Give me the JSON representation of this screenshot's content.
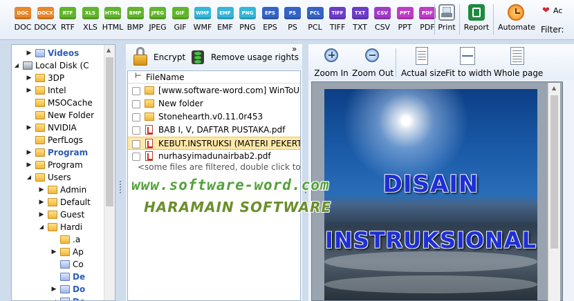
{
  "formats": [
    {
      "label": "DOC",
      "color": "#e8862a"
    },
    {
      "label": "DOCX",
      "color": "#e8862a"
    },
    {
      "label": "RTF",
      "color": "#61b52b"
    },
    {
      "label": "XLS",
      "color": "#61b52b"
    },
    {
      "label": "HTML",
      "color": "#61b52b"
    },
    {
      "label": "BMP",
      "color": "#61b52b"
    },
    {
      "label": "JPEG",
      "color": "#61b52b"
    },
    {
      "label": "GIF",
      "color": "#61b52b"
    },
    {
      "label": "WMF",
      "color": "#34b6d9"
    },
    {
      "label": "EMF",
      "color": "#34b6d9"
    },
    {
      "label": "PNG",
      "color": "#34b6d9"
    },
    {
      "label": "EPS",
      "color": "#3563c6"
    },
    {
      "label": "PS",
      "color": "#3563c6"
    },
    {
      "label": "PCL",
      "color": "#3563c6"
    },
    {
      "label": "TIFF",
      "color": "#6c3cc7"
    },
    {
      "label": "TXT",
      "color": "#6c3cc7"
    },
    {
      "label": "CSV",
      "color": "#9f3cc7"
    },
    {
      "label": "PPT",
      "color": "#c03cc7"
    },
    {
      "label": "PDF",
      "color": "#c03cc7"
    }
  ],
  "toolbar": {
    "print": "Print",
    "report": "Report",
    "automate": "Automate",
    "filter": "Filter:",
    "ac": "Ac"
  },
  "tree": [
    {
      "label": "Videos",
      "depth": 1,
      "arrow": "right",
      "bold": true,
      "color": "#2b5cb3",
      "special": true
    },
    {
      "label": "Local Disk (C",
      "depth": 0,
      "arrow": "down",
      "drive": true
    },
    {
      "label": "3DP",
      "depth": 1,
      "arrow": "right"
    },
    {
      "label": "Intel",
      "depth": 1,
      "arrow": "right"
    },
    {
      "label": "MSOCache",
      "depth": 1,
      "arrow": ""
    },
    {
      "label": "New Folder",
      "depth": 1,
      "arrow": ""
    },
    {
      "label": "NVIDIA",
      "depth": 1,
      "arrow": "right"
    },
    {
      "label": "PerfLogs",
      "depth": 1,
      "arrow": ""
    },
    {
      "label": "Program",
      "depth": 1,
      "arrow": "right",
      "bold": true,
      "color": "#2b5cb3"
    },
    {
      "label": "Program",
      "depth": 1,
      "arrow": "right"
    },
    {
      "label": "Users",
      "depth": 1,
      "arrow": "down"
    },
    {
      "label": "Admin",
      "depth": 2,
      "arrow": "right"
    },
    {
      "label": "Default",
      "depth": 2,
      "arrow": "right"
    },
    {
      "label": "Guest",
      "depth": 2,
      "arrow": "right"
    },
    {
      "label": "Hardi",
      "depth": 2,
      "arrow": "down"
    },
    {
      "label": ".a",
      "depth": 3,
      "arrow": ""
    },
    {
      "label": "Ap",
      "depth": 3,
      "arrow": "right"
    },
    {
      "label": "Co",
      "depth": 3,
      "arrow": "",
      "special": true
    },
    {
      "label": "De",
      "depth": 3,
      "arrow": "",
      "bold": true,
      "color": "#2b5cb3",
      "special": true
    },
    {
      "label": "Do",
      "depth": 3,
      "arrow": "right",
      "bold": true,
      "color": "#2b5cb3",
      "special": true
    },
    {
      "label": "Do",
      "depth": 3,
      "arrow": "down",
      "bold": true,
      "color": "#2b5cb3",
      "special": true
    }
  ],
  "filePanel": {
    "encrypt": "Encrypt",
    "removeUsage": "Remove usage rights",
    "more": "»",
    "columnHeader": "FileName",
    "files": [
      {
        "name": "[www.software-word.com] WinToUSB",
        "type": "folder"
      },
      {
        "name": "New folder",
        "type": "folder"
      },
      {
        "name": "Stonehearth.v0.11.0r453",
        "type": "folder"
      },
      {
        "name": "BAB I, V, DAFTAR PUSTAKA.pdf",
        "type": "pdf"
      },
      {
        "name": "KEBUT.INSTRUKSI (MATERI PEKERTI",
        "type": "pdf",
        "selected": true
      },
      {
        "name": "nurhasyimadunairbab2.pdf",
        "type": "pdf"
      }
    ],
    "filteredNote": "<some files are filtered, double click to"
  },
  "preview": {
    "zoomIn": "Zoom In",
    "zoomOut": "Zoom Out",
    "actualSize": "Actual size",
    "fitToWidth": "Fit to width",
    "wholePage": "Whole page",
    "docTitle1": "DISAIN",
    "docTitle2": "INSTRUKSIONAL"
  },
  "watermark": {
    "line1": "www.software-word.com",
    "line2": "HARAMAIN SOFTWARE"
  }
}
